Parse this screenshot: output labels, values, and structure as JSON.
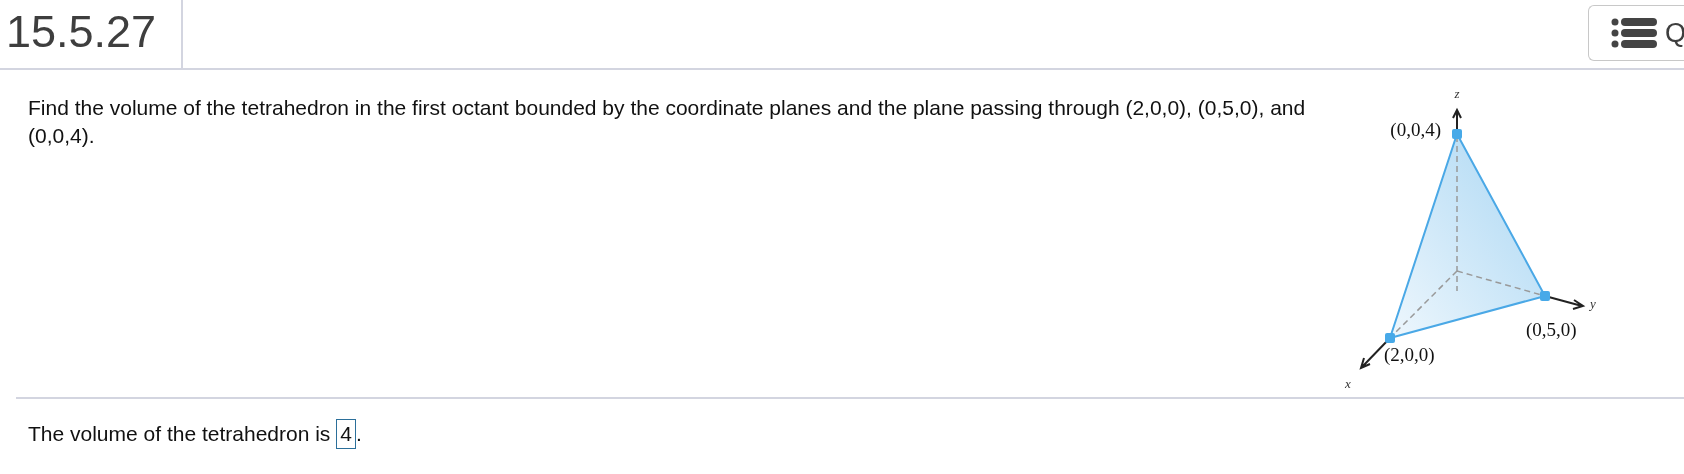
{
  "header": {
    "title": "15.5.27",
    "menu_button": {
      "label": "Q"
    }
  },
  "question": {
    "text": "Find the volume of the tetrahedron in the first octant bounded by the coordinate planes and the plane passing through (2,0,0), (0,5,0), and (0,0,4).",
    "figure": {
      "axis_labels": {
        "x": "x",
        "y": "y",
        "z": "z"
      },
      "points": [
        {
          "label": "(0,0,4)"
        },
        {
          "label": "(0,5,0)"
        },
        {
          "label": "(2,0,0)"
        }
      ]
    }
  },
  "answer": {
    "before": "The volume of the tetrahedron is",
    "value": "4",
    "after": "."
  }
}
